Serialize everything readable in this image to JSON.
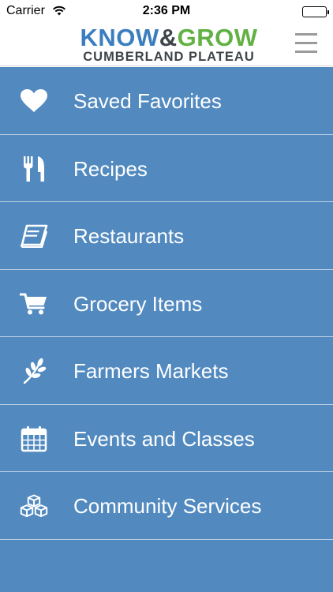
{
  "status_bar": {
    "carrier": "Carrier",
    "time": "2:36 PM",
    "battery": 1.0
  },
  "header": {
    "logo_know": "KNOW",
    "logo_amp": "&",
    "logo_grow": "GROW",
    "logo_subtitle": "CUMBERLAND PLATEAU"
  },
  "menu": {
    "items": [
      {
        "label": "Saved Favorites",
        "icon": "heart-icon"
      },
      {
        "label": "Recipes",
        "icon": "utensils-icon"
      },
      {
        "label": "Restaurants",
        "icon": "book-icon"
      },
      {
        "label": "Grocery Items",
        "icon": "shopping-cart-icon"
      },
      {
        "label": "Farmers Markets",
        "icon": "leaf-icon"
      },
      {
        "label": "Events and Classes",
        "icon": "calendar-icon"
      },
      {
        "label": "Community Services",
        "icon": "cubes-icon"
      }
    ]
  },
  "colors": {
    "menu_background": "#528ac0",
    "divider": "#b8cde2",
    "logo_know": "#3b7ec0",
    "logo_grow": "#61b143",
    "logo_dark": "#3e4448"
  }
}
